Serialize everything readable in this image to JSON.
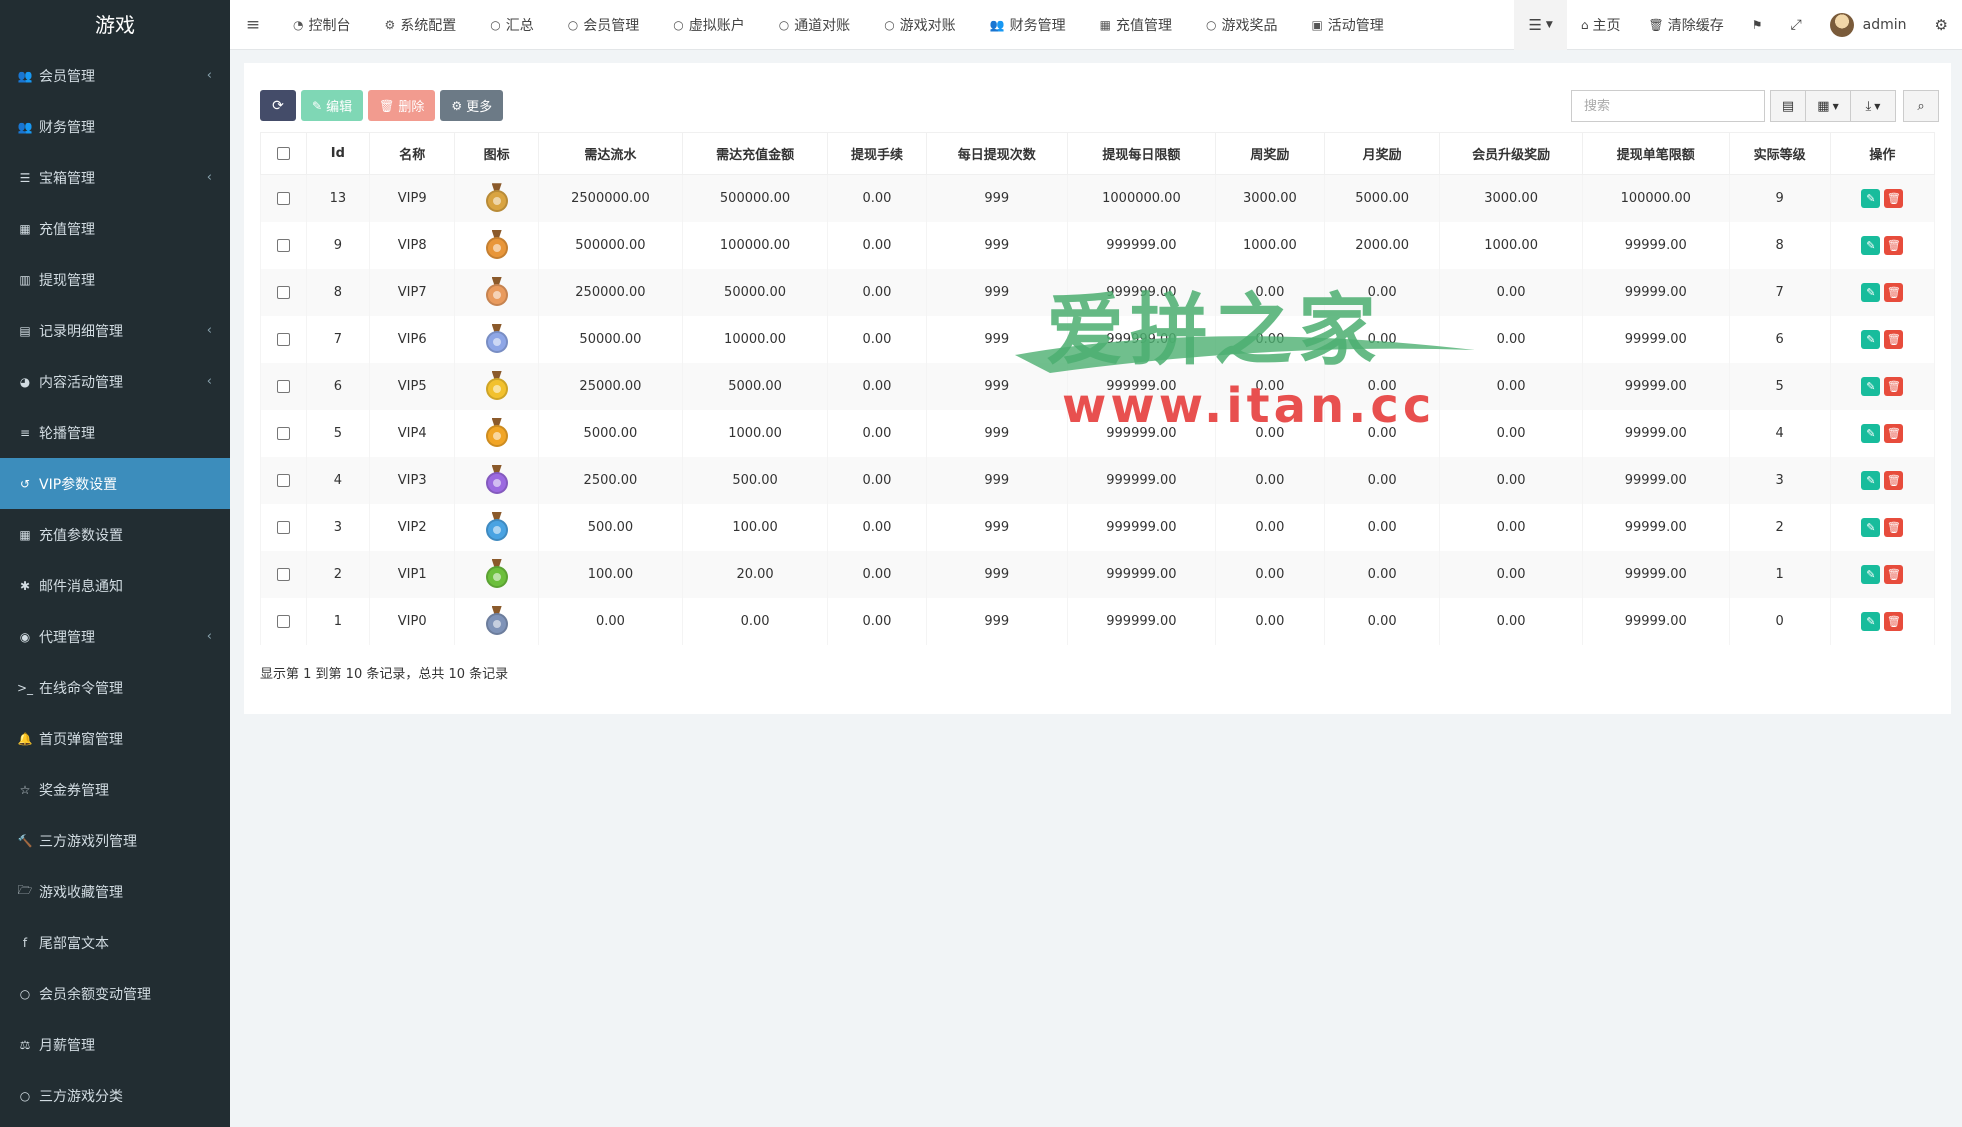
{
  "app": {
    "title": "游戏"
  },
  "sidebar": {
    "items": [
      {
        "label": "会员管理",
        "icon": "users-icon",
        "glyph": "👥",
        "chevron": true
      },
      {
        "label": "财务管理",
        "icon": "users-icon",
        "glyph": "👥",
        "chevron": false
      },
      {
        "label": "宝箱管理",
        "icon": "list-icon",
        "glyph": "☰",
        "chevron": true
      },
      {
        "label": "充值管理",
        "icon": "grid-icon",
        "glyph": "▦",
        "chevron": false
      },
      {
        "label": "提现管理",
        "icon": "bank-icon",
        "glyph": "▥",
        "chevron": false
      },
      {
        "label": "记录明细管理",
        "icon": "chart-icon",
        "glyph": "▤",
        "chevron": true
      },
      {
        "label": "内容活动管理",
        "icon": "dashboard-icon",
        "glyph": "◕",
        "chevron": true
      },
      {
        "label": "轮播管理",
        "icon": "bars-icon",
        "glyph": "≡",
        "chevron": false
      },
      {
        "label": "VIP参数设置",
        "icon": "history-icon",
        "glyph": "↺",
        "chevron": false,
        "active": true
      },
      {
        "label": "充值参数设置",
        "icon": "grid-icon",
        "glyph": "▦",
        "chevron": false
      },
      {
        "label": "邮件消息通知",
        "icon": "asterisk-icon",
        "glyph": "✱",
        "chevron": false
      },
      {
        "label": "代理管理",
        "icon": "user-circle-icon",
        "glyph": "◉",
        "chevron": true
      },
      {
        "label": "在线命令管理",
        "icon": "terminal-icon",
        "glyph": ">_",
        "chevron": false
      },
      {
        "label": "首页弹窗管理",
        "icon": "bell-icon",
        "glyph": "🔔",
        "chevron": false
      },
      {
        "label": "奖金券管理",
        "icon": "star-icon",
        "glyph": "☆",
        "chevron": false
      },
      {
        "label": "三方游戏列管理",
        "icon": "gavel-icon",
        "glyph": "🔨",
        "chevron": false
      },
      {
        "label": "游戏收藏管理",
        "icon": "folder-icon",
        "glyph": "🗁",
        "chevron": false
      },
      {
        "label": "尾部富文本",
        "icon": "facebook-icon",
        "glyph": "f",
        "chevron": false
      },
      {
        "label": "会员余额变动管理",
        "icon": "circle-icon",
        "glyph": "○",
        "chevron": false
      },
      {
        "label": "月薪管理",
        "icon": "balance-icon",
        "glyph": "⚖",
        "chevron": false
      },
      {
        "label": "三方游戏分类",
        "icon": "circle-icon",
        "glyph": "○",
        "chevron": false
      }
    ]
  },
  "topnav": {
    "menu_glyph": "≡",
    "items": [
      {
        "label": "控制台",
        "icon": "dashboard-icon",
        "glyph": "◔"
      },
      {
        "label": "系统配置",
        "icon": "gear-icon",
        "glyph": "⚙"
      },
      {
        "label": "汇总",
        "icon": "circle-icon",
        "glyph": "○"
      },
      {
        "label": "会员管理",
        "icon": "circle-icon",
        "glyph": "○"
      },
      {
        "label": "虚拟账户",
        "icon": "circle-icon",
        "glyph": "○"
      },
      {
        "label": "通道对账",
        "icon": "circle-icon",
        "glyph": "○"
      },
      {
        "label": "游戏对账",
        "icon": "circle-icon",
        "glyph": "○"
      },
      {
        "label": "财务管理",
        "icon": "users-icon",
        "glyph": "👥"
      },
      {
        "label": "充值管理",
        "icon": "grid-icon",
        "glyph": "▦"
      },
      {
        "label": "游戏奖品",
        "icon": "circle-icon",
        "glyph": "○"
      },
      {
        "label": "活动管理",
        "icon": "calendar-icon",
        "glyph": "▣"
      }
    ],
    "right": {
      "home": "主页",
      "clear_cache": "清除缓存",
      "user": "admin"
    }
  },
  "toolbar": {
    "edit": "编辑",
    "delete": "删除",
    "more": "更多",
    "search_placeholder": "搜索"
  },
  "table": {
    "columns": [
      "Id",
      "名称",
      "图标",
      "需达流水",
      "需达充值金额",
      "提现手续",
      "每日提现次数",
      "提现每日限额",
      "周奖励",
      "月奖励",
      "会员升级奖励",
      "提现单笔限额",
      "实际等级",
      "操作"
    ],
    "rows": [
      {
        "id": "13",
        "name": "VIP9",
        "medal": "#d9a441",
        "flow": "2500000.00",
        "recharge": "500000.00",
        "fee": "0.00",
        "times": "999",
        "daily": "1000000.00",
        "week": "3000.00",
        "month": "5000.00",
        "upgrade": "3000.00",
        "single": "100000.00",
        "level": "9"
      },
      {
        "id": "9",
        "name": "VIP8",
        "medal": "#e8963a",
        "flow": "500000.00",
        "recharge": "100000.00",
        "fee": "0.00",
        "times": "999",
        "daily": "999999.00",
        "week": "1000.00",
        "month": "2000.00",
        "upgrade": "1000.00",
        "single": "99999.00",
        "level": "8"
      },
      {
        "id": "8",
        "name": "VIP7",
        "medal": "#e99b5e",
        "flow": "250000.00",
        "recharge": "50000.00",
        "fee": "0.00",
        "times": "999",
        "daily": "999999.00",
        "week": "0.00",
        "month": "0.00",
        "upgrade": "0.00",
        "single": "99999.00",
        "level": "7"
      },
      {
        "id": "7",
        "name": "VIP6",
        "medal": "#8ea6e6",
        "flow": "50000.00",
        "recharge": "10000.00",
        "fee": "0.00",
        "times": "999",
        "daily": "999999.00",
        "week": "0.00",
        "month": "0.00",
        "upgrade": "0.00",
        "single": "99999.00",
        "level": "6"
      },
      {
        "id": "6",
        "name": "VIP5",
        "medal": "#f2c12e",
        "flow": "25000.00",
        "recharge": "5000.00",
        "fee": "0.00",
        "times": "999",
        "daily": "999999.00",
        "week": "0.00",
        "month": "0.00",
        "upgrade": "0.00",
        "single": "99999.00",
        "level": "5"
      },
      {
        "id": "5",
        "name": "VIP4",
        "medal": "#f1a526",
        "flow": "5000.00",
        "recharge": "1000.00",
        "fee": "0.00",
        "times": "999",
        "daily": "999999.00",
        "week": "0.00",
        "month": "0.00",
        "upgrade": "0.00",
        "single": "99999.00",
        "level": "4"
      },
      {
        "id": "4",
        "name": "VIP3",
        "medal": "#9c6ae0",
        "flow": "2500.00",
        "recharge": "500.00",
        "fee": "0.00",
        "times": "999",
        "daily": "999999.00",
        "week": "0.00",
        "month": "0.00",
        "upgrade": "0.00",
        "single": "99999.00",
        "level": "3"
      },
      {
        "id": "3",
        "name": "VIP2",
        "medal": "#4aa3e2",
        "flow": "500.00",
        "recharge": "100.00",
        "fee": "0.00",
        "times": "999",
        "daily": "999999.00",
        "week": "0.00",
        "month": "0.00",
        "upgrade": "0.00",
        "single": "99999.00",
        "level": "2"
      },
      {
        "id": "2",
        "name": "VIP1",
        "medal": "#6cbf3c",
        "flow": "100.00",
        "recharge": "20.00",
        "fee": "0.00",
        "times": "999",
        "daily": "999999.00",
        "week": "0.00",
        "month": "0.00",
        "upgrade": "0.00",
        "single": "99999.00",
        "level": "1"
      },
      {
        "id": "1",
        "name": "VIP0",
        "medal": "#7f93b8",
        "flow": "0.00",
        "recharge": "0.00",
        "fee": "0.00",
        "times": "999",
        "daily": "999999.00",
        "week": "0.00",
        "month": "0.00",
        "upgrade": "0.00",
        "single": "99999.00",
        "level": "0"
      }
    ]
  },
  "pagination_info": "显示第 1 到第 10 条记录，总共 10 条记录",
  "watermark": {
    "line1": "爱拼之家",
    "line2": "www.itan.cc"
  },
  "colors": {
    "sidebar_bg": "#222d32",
    "active": "#3c8dbc",
    "edit": "#18bc9c",
    "delete": "#e74c3c"
  }
}
